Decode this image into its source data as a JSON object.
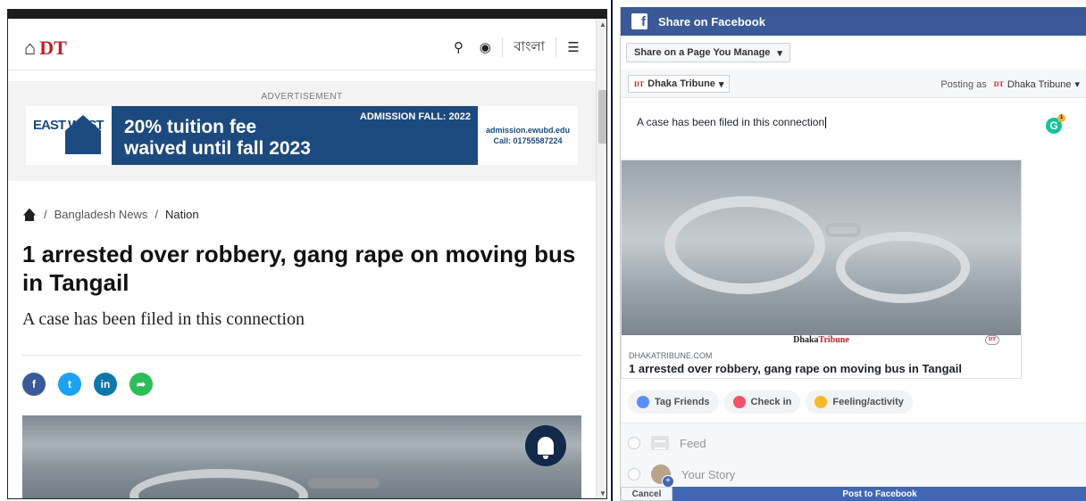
{
  "site": {
    "logo_text": "DT",
    "header_icons": [
      "search-icon",
      "globe-icon"
    ],
    "language_label": "বাংলা"
  },
  "ad": {
    "label": "ADVERTISEMENT",
    "logo_text": "EAST WEST",
    "headline_line1": "20% tuition fee",
    "headline_line2": "waived until fall 2023",
    "admission": "ADMISSION FALL: 2022",
    "contact_web": "admission.ewubd.edu",
    "contact_phone": "Call: 01755587224"
  },
  "article": {
    "breadcrumbs": [
      "Bangladesh News",
      "Nation"
    ],
    "separator": "/",
    "title": "1 arrested over robbery, gang rape on moving bus in Tangail",
    "subtitle": "A case has been filed in this connection",
    "share_buttons": [
      {
        "name": "facebook",
        "glyph": "f",
        "color": "#3b5998"
      },
      {
        "name": "twitter",
        "glyph": "t",
        "color": "#1da1f2"
      },
      {
        "name": "linkedin",
        "glyph": "in",
        "color": "#0e76a8"
      },
      {
        "name": "share",
        "glyph": "➦",
        "color": "#2ebd59"
      }
    ]
  },
  "facebook": {
    "window_title": "Share on Facebook",
    "share_target": "Share on a Page You Manage",
    "page_name": "Dhaka Tribune",
    "page_mark": "DT",
    "posting_as_label": "Posting as",
    "posting_as_value": "Dhaka Tribune",
    "message": "A case has been filed in this connection",
    "preview_watermark_a": "Dhaka",
    "preview_watermark_b": "Tribune",
    "preview_badge": "DT",
    "preview_domain": "DHAKATRIBUNE.COM",
    "preview_title": "1 arrested over robbery, gang rape on moving bus in Tangail",
    "actions": [
      "Tag Friends",
      "Check in",
      "Feeling/activity"
    ],
    "destinations": [
      "Feed",
      "Your Story"
    ],
    "cancel_label": "Cancel",
    "post_label": "Post to Facebook",
    "grammarly_badge": "1"
  },
  "colors": {
    "fb_blue": "#3b5998",
    "post_blue": "#4267b2",
    "dt_red": "#c0202a",
    "ad_navy": "#1d4a7e"
  }
}
